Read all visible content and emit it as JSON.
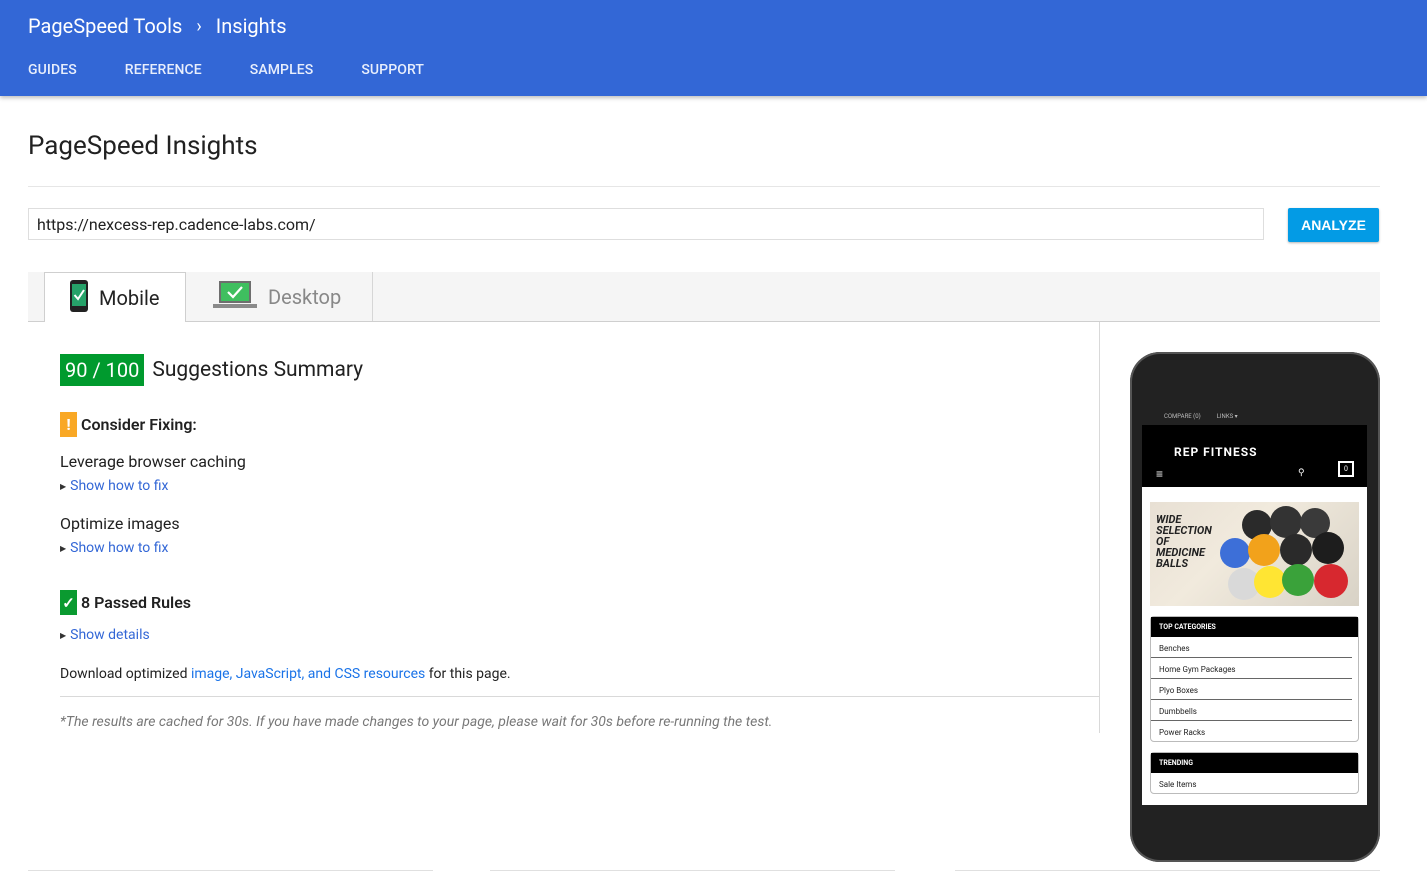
{
  "header": {
    "brand": "PageSpeed Tools",
    "breadcrumb_current": "Insights",
    "nav": [
      "GUIDES",
      "REFERENCE",
      "SAMPLES",
      "SUPPORT"
    ]
  },
  "page": {
    "title": "PageSpeed Insights",
    "url_value": "https://nexcess-rep.cadence-labs.com/",
    "analyze_label": "ANALYZE"
  },
  "tabs": [
    {
      "label": "Mobile",
      "active": true,
      "icon": "mobile-check-icon"
    },
    {
      "label": "Desktop",
      "active": false,
      "icon": "laptop-check-icon"
    }
  ],
  "summary": {
    "score": "90 / 100",
    "title": "Suggestions Summary"
  },
  "consider": {
    "badge": "!",
    "label": "Consider Fixing:",
    "rules": [
      {
        "name": "Leverage browser caching",
        "link": "Show how to fix"
      },
      {
        "name": "Optimize images",
        "link": "Show how to fix"
      }
    ]
  },
  "passed": {
    "badge": "✓",
    "label": "8 Passed Rules",
    "link": "Show details"
  },
  "download": {
    "prefix": "Download optimized ",
    "link": "image, JavaScript, and CSS resources",
    "suffix": " for this page."
  },
  "cache_note": "*The results are cached for 30s. If you have made changes to your page, please wait for 30s before re-running the test.",
  "phone": {
    "top_links": [
      "COMPARE (0)",
      "LINKS ▾"
    ],
    "logo": "REP FITNESS",
    "cart_count": "0",
    "banner_text": [
      "WIDE",
      "SELECTION",
      "OF",
      "MEDICINE",
      "BALLS"
    ],
    "categories_title": "TOP CATEGORIES",
    "categories": [
      "Benches",
      "Home Gym Packages",
      "Plyo Boxes",
      "Dumbbells",
      "Power Racks"
    ],
    "trending_title": "TRENDING",
    "trending": [
      "Sale Items"
    ]
  },
  "colors": {
    "header_bg": "#3367d6",
    "analyze_bg": "#039be5",
    "score_bg": "#009a2e",
    "warn": "#f9a825",
    "link": "#3367d6"
  }
}
